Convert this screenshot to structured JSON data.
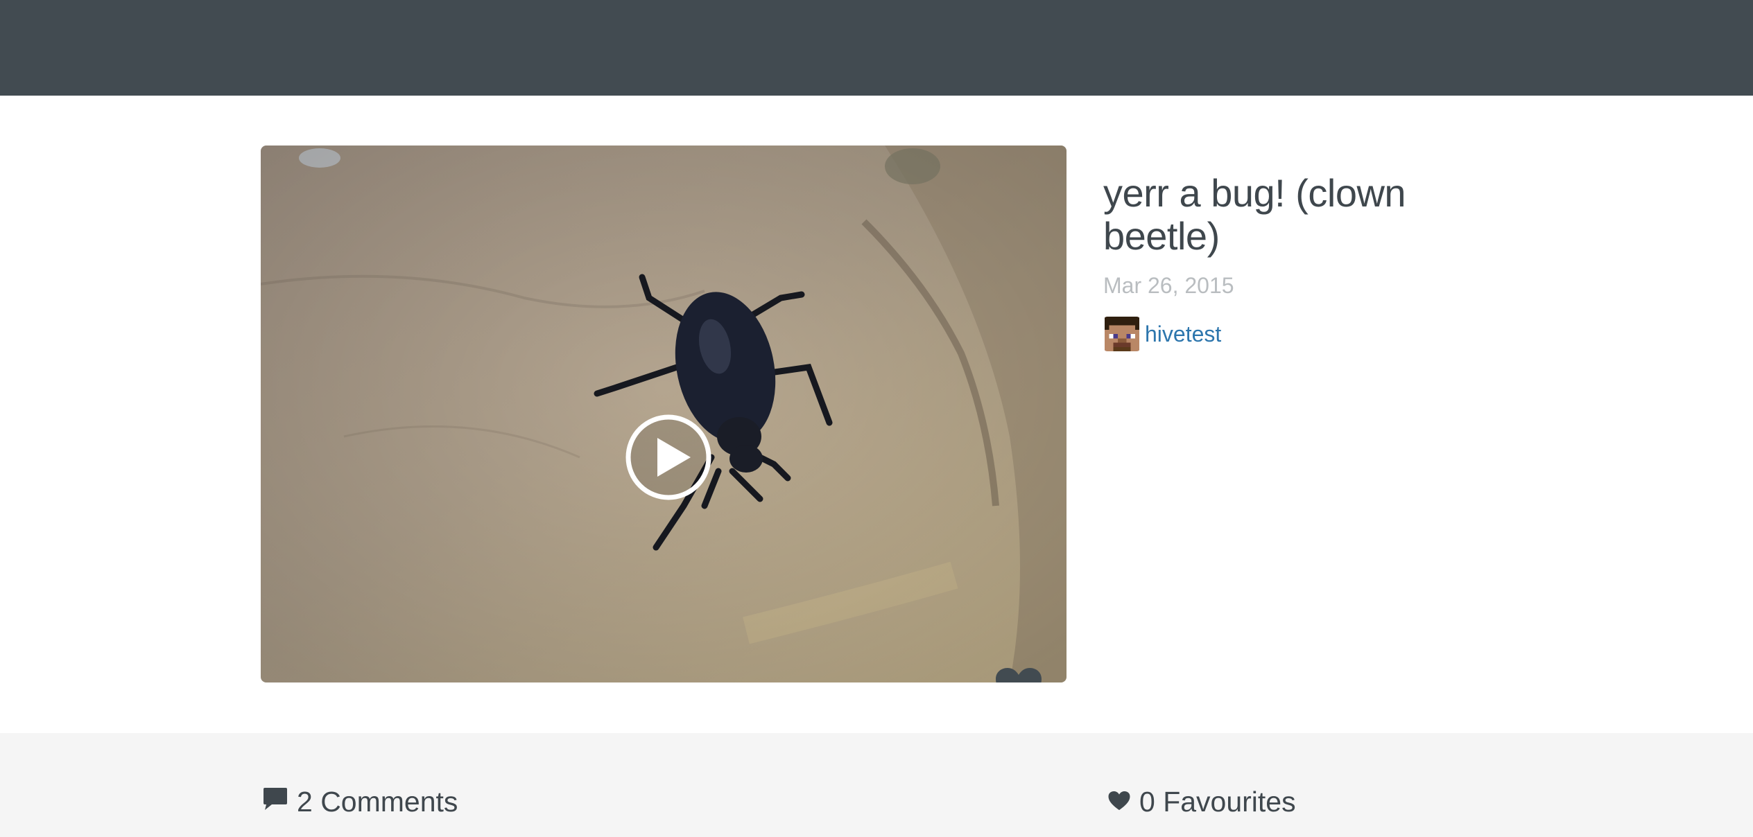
{
  "post": {
    "title": "yerr a bug! (clown beetle)",
    "date": "Mar 26, 2015",
    "author": "hivetest"
  },
  "stats": {
    "comments_label": "2 Comments",
    "favourites_label": "0 Favourites"
  },
  "icons": {
    "play": "play-circle-icon",
    "favourite_overlay": "heart-icon",
    "comments": "speech-bubble-icon",
    "favourites": "heart-icon"
  },
  "colors": {
    "header": "#424b51",
    "text": "#3f474d",
    "date": "#b9bdc0",
    "link": "#2d76ad",
    "lower_bg": "#f5f5f5"
  }
}
